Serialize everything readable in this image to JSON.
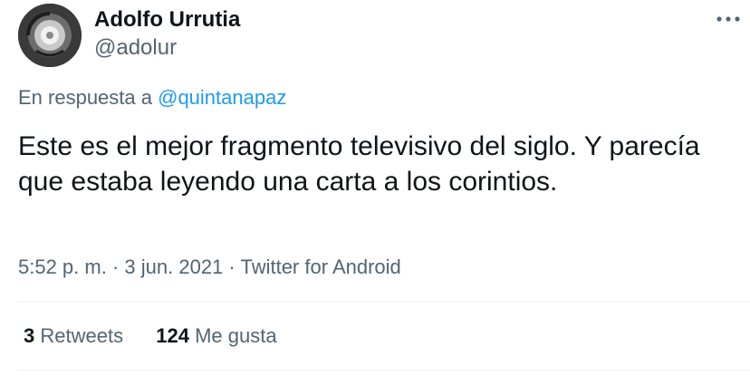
{
  "author": {
    "display_name": "Adolfo Urrutia",
    "handle": "@adolur"
  },
  "reply": {
    "prefix": "En respuesta a",
    "mention": "@quintanapaz"
  },
  "tweet": {
    "text": "Este es el mejor fragmento televisivo del siglo. Y parecía que estaba leyendo una carta a los corintios."
  },
  "meta": {
    "time": "5:52 p. m.",
    "sep1": "·",
    "date": "3 jun. 2021",
    "sep2": "·",
    "source": "Twitter for Android"
  },
  "stats": {
    "retweets_count": "3",
    "retweets_label": "Retweets",
    "likes_count": "124",
    "likes_label": "Me gusta"
  },
  "icons": {
    "more": "more-options-icon"
  },
  "colors": {
    "text_primary": "#0f1419",
    "text_secondary": "#536471",
    "link": "#1d9bf0",
    "divider": "#eff3f4"
  }
}
